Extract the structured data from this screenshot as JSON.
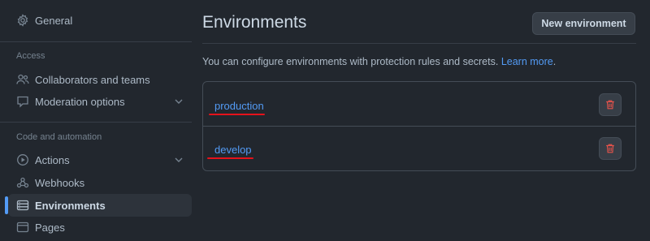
{
  "sidebar": {
    "general": {
      "label": "General",
      "icon": "gear-icon"
    },
    "access_section": "Access",
    "collaborators": {
      "label": "Collaborators and teams",
      "icon": "people-icon"
    },
    "moderation": {
      "label": "Moderation options",
      "icon": "comment-icon"
    },
    "code_section": "Code and automation",
    "actions": {
      "label": "Actions",
      "icon": "play-icon"
    },
    "webhooks": {
      "label": "Webhooks",
      "icon": "webhook-icon"
    },
    "environments": {
      "label": "Environments",
      "icon": "server-icon"
    },
    "pages": {
      "label": "Pages",
      "icon": "browser-icon"
    }
  },
  "main": {
    "title": "Environments",
    "new_button": "New environment",
    "description": "You can configure environments with protection rules and secrets.",
    "learn_more": "Learn more",
    "period": ".",
    "environments": [
      {
        "name": "production"
      },
      {
        "name": "develop"
      }
    ]
  },
  "colors": {
    "background": "#22272e",
    "accent": "#539bf5",
    "danger": "#e5534b",
    "annotation_underline": "#e5121b"
  }
}
